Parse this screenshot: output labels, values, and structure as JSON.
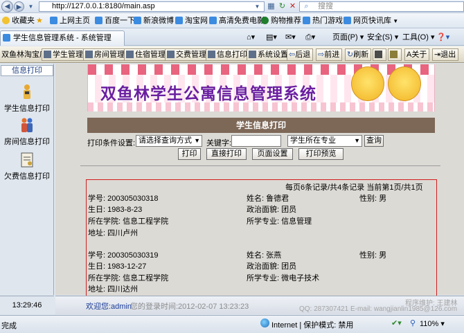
{
  "browser": {
    "url": "http://127.0.0.1:8180/main.asp",
    "search_placeholder": "搜搜",
    "tab_title": "学生信息管理系统 - 系统管理",
    "favorites_label": "收藏夹",
    "favorites": [
      "上网主页",
      "百度一下",
      "新浪微博",
      "淘宝网",
      "高清免费电影",
      "购物推荐",
      "热门游戏",
      "网页快讯库"
    ],
    "commands": [
      "页面(P)",
      "安全(S)",
      "工具(O)"
    ],
    "status_left": "完成",
    "status_zone": "Internet | 保护模式: 禁用",
    "zoom": "110%"
  },
  "toolbar": {
    "shop": "双鱼林淘宝店",
    "buttons": [
      "学生管理",
      "房间管理",
      "住宿管理",
      "交费管理",
      "信息打印",
      "系统设置",
      "后退",
      "前进",
      "刷新",
      "关于",
      "退出"
    ]
  },
  "sidebar": {
    "header": "信息打印",
    "items": [
      "学生信息打印",
      "房间信息打印",
      "欠费信息打印"
    ],
    "clock": "13:29:46"
  },
  "banner": {
    "title": "双鱼林学生公寓信息管理系统"
  },
  "section": {
    "title": "学生信息打印",
    "print_settings_label": "打印条件设置:",
    "query_method": "请选择查询方式",
    "keyword_label": "关键字:",
    "keyword_value": "",
    "field": "学生所在专业",
    "query_button": "查询",
    "print_button": "打印",
    "direct_print_button": "直接打印",
    "page_setup_button": "页面设置",
    "print_preview_button": "打印预览"
  },
  "list": {
    "pager": "每页6条记录/共4条记录  当前第1页/共1页",
    "students": [
      {
        "id_label": "学号:",
        "id": "200305030318",
        "name_label": "姓名:",
        "name": "鲁德君",
        "gender_label": "性别:",
        "gender": "男",
        "birth_label": "生日:",
        "birth": "1983-8-23",
        "politics_label": "政治面貌:",
        "politics": "团员",
        "college_label": "所在学院:",
        "college": "信息工程学院",
        "major_label": "所学专业:",
        "major": "信息管理",
        "address_label": "地址:",
        "address": "四川卢州"
      },
      {
        "id_label": "学号:",
        "id": "200305030319",
        "name_label": "姓名:",
        "name": "张燕",
        "gender_label": "性别:",
        "gender": "男",
        "birth_label": "生日:",
        "birth": "1983-12-27",
        "politics_label": "政治面貌:",
        "politics": "团员",
        "college_label": "所在学院:",
        "college": "信息工程学院",
        "major_label": "所学专业:",
        "major": "微电子技术",
        "address_label": "地址:",
        "address": "四川达州"
      }
    ]
  },
  "footer": {
    "welcome": "欢迎您:admin",
    "login_time": "您的登录时间:2012-02-07 13:23:23",
    "maintainer": "程序维护: 王建林",
    "contact": "QQ: 287307421 E-mail: wangjianlin1985@126.com"
  },
  "colors": {
    "section_bar": "#7d6757",
    "list_border": "#d11d1d",
    "banner_title": "#6a1fa0"
  }
}
